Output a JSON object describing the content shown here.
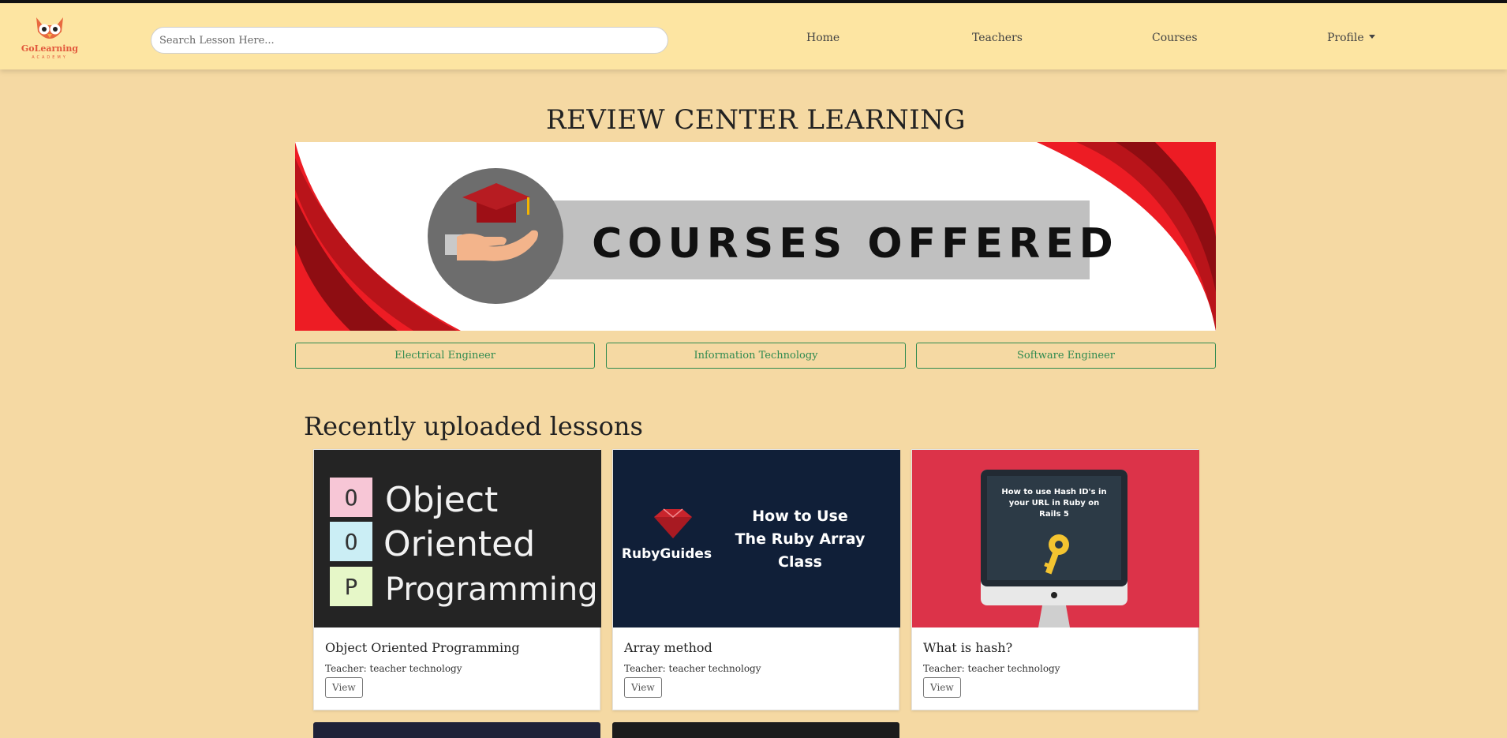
{
  "header": {
    "logo_text": "GoLearning",
    "logo_subtext": "ACADEMY",
    "search_placeholder": "Search Lesson Here...",
    "nav": [
      {
        "label": "Home"
      },
      {
        "label": "Teachers"
      },
      {
        "label": "Courses"
      },
      {
        "label": "Profile"
      }
    ]
  },
  "page_title": "REVIEW CENTER LEARNING",
  "banner": {
    "text": "COURSES  OFFERED"
  },
  "courses": [
    {
      "label": "Electrical Engineer"
    },
    {
      "label": "Information Technology"
    },
    {
      "label": "Software Engineer"
    }
  ],
  "recent": {
    "heading": "Recently uploaded lessons",
    "lessons": [
      {
        "title": "Object Oriented Programming",
        "teacher": "Teacher: teacher technology",
        "view_label": "View",
        "image_words": [
          "Object",
          "Oriented",
          "Programming"
        ],
        "image_letters": [
          "O",
          "O",
          "P"
        ]
      },
      {
        "title": "Array method",
        "teacher": "Teacher: teacher technology",
        "view_label": "View",
        "image_brand": "RubyGuides",
        "image_lines": [
          "How to Use",
          "The Ruby Array",
          "Class"
        ]
      },
      {
        "title": "What is hash?",
        "teacher": "Teacher: teacher technology",
        "view_label": "View",
        "image_lines": [
          "How to use Hash ID's in",
          "your URL in Ruby on",
          "Rails 5"
        ]
      }
    ]
  },
  "colors": {
    "page_bg": "#f5d9a3",
    "header_bg": "#fde5a2",
    "course_button": "#2f8a4f",
    "banner_red": "#ed1c24",
    "card2_bg": "#101f38",
    "card3_bg": "#dc3349"
  }
}
